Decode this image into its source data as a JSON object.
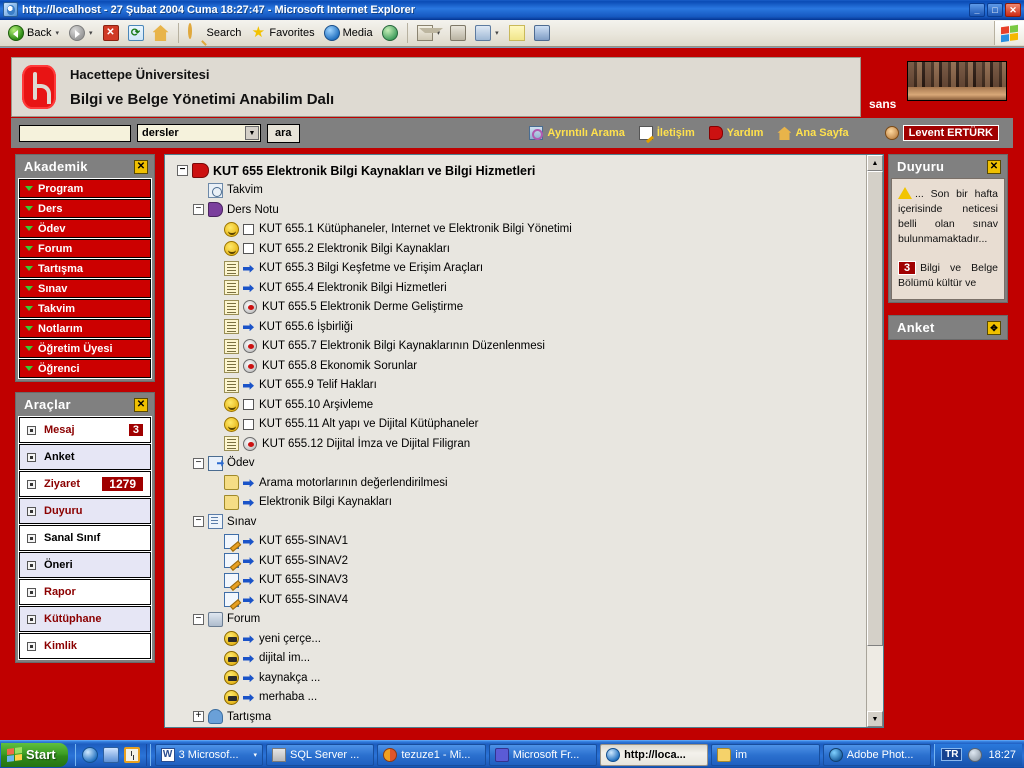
{
  "window": {
    "title": "http://localhost - 27 Şubat 2004 Cuma 18:27:47 - Microsoft Internet Explorer",
    "minimize": "_",
    "maximize": "□",
    "close": "✕"
  },
  "toolbar": {
    "back": "Back",
    "back_caret": "▾",
    "forward_caret": "▾",
    "stop": "✕",
    "refresh": "⟳",
    "search": "Search",
    "favorites": "Favorites",
    "media": "Media",
    "mail_caret": "▾",
    "print_caret": "▾",
    "history_caret": "▾"
  },
  "site": {
    "university": "Hacettepe Üniversitesi",
    "department": "Bilgi ve Belge Yönetimi Anabilim Dalı",
    "photo_caption": "sans"
  },
  "search": {
    "value": "",
    "placeholder": "",
    "selected": "dersler",
    "select_caret": "▼",
    "button": "ara",
    "links": [
      {
        "icon": "detailed-search-icon",
        "label": "Ayrıntılı Arama"
      },
      {
        "icon": "contact-icon",
        "label": "İletişim"
      },
      {
        "icon": "help-icon",
        "label": "Yardım"
      },
      {
        "icon": "home-icon",
        "label": "Ana Sayfa"
      }
    ],
    "user": "Levent ERTÜRK"
  },
  "sidebar": {
    "academic": {
      "title": "Akademik",
      "close": "✕",
      "items": [
        "Program",
        "Ders",
        "Ödev",
        "Forum",
        "Tartışma",
        "Sınav",
        "Takvim",
        "Notlarım",
        "Öğretim Üyesi",
        "Öğrenci"
      ]
    },
    "tools": {
      "title": "Araçlar",
      "close": "✕",
      "items": [
        {
          "label": "Mesaj",
          "badge": "3",
          "style": "dark"
        },
        {
          "label": "Anket",
          "badge": "",
          "style": "black"
        },
        {
          "label": "Ziyaret",
          "badge": "1279",
          "style": "dark"
        },
        {
          "label": "Duyuru",
          "badge": "",
          "style": "dark"
        },
        {
          "label": "Sanal Sınıf",
          "badge": "",
          "style": "black"
        },
        {
          "label": "Öneri",
          "badge": "",
          "style": "black"
        },
        {
          "label": "Rapor",
          "badge": "",
          "style": "dark"
        },
        {
          "label": "Kütüphane",
          "badge": "",
          "style": "dark"
        },
        {
          "label": "Kimlik",
          "badge": "",
          "style": "dark"
        }
      ]
    }
  },
  "tree": {
    "rows": [
      {
        "indent": 0,
        "expander": "−",
        "icon": "book-icon",
        "marker": "",
        "label": "KUT 655  Elektronik Bilgi Kaynakları ve Bilgi Hizmetleri",
        "big": true
      },
      {
        "indent": 1,
        "expander": "",
        "icon": "calendar-icon",
        "marker": "",
        "label": "Takvim"
      },
      {
        "indent": 1,
        "expander": "−",
        "icon": "notes-icon",
        "marker": "",
        "label": "Ders Notu"
      },
      {
        "indent": 2,
        "expander": "",
        "icon": "face-icon",
        "marker": "checkbox",
        "label": "KUT 655.1 Kütüphaneler, Internet ve Elektronik Bilgi Yönetimi"
      },
      {
        "indent": 2,
        "expander": "",
        "icon": "face-icon",
        "marker": "checkbox",
        "label": "KUT 655.2 Elektronik Bilgi Kaynakları"
      },
      {
        "indent": 2,
        "expander": "",
        "icon": "document-icon",
        "marker": "arrow",
        "label": "KUT 655.3 Bilgi Keşfetme ve Erişim Araçları"
      },
      {
        "indent": 2,
        "expander": "",
        "icon": "document-icon",
        "marker": "arrow",
        "label": "KUT 655.4 Elektronik Bilgi Hizmetleri"
      },
      {
        "indent": 2,
        "expander": "",
        "icon": "document-icon",
        "marker": "smiley",
        "label": "KUT 655.5 Elektronik Derme Geliştirme"
      },
      {
        "indent": 2,
        "expander": "",
        "icon": "document-icon",
        "marker": "arrow",
        "label": "KUT 655.6 İşbirliği"
      },
      {
        "indent": 2,
        "expander": "",
        "icon": "document-icon",
        "marker": "smiley",
        "label": "KUT 655.7 Elektronik Bilgi Kaynaklarının Düzenlenmesi"
      },
      {
        "indent": 2,
        "expander": "",
        "icon": "document-icon",
        "marker": "smiley",
        "label": "KUT 655.8 Ekonomik Sorunlar"
      },
      {
        "indent": 2,
        "expander": "",
        "icon": "document-icon",
        "marker": "arrow",
        "label": "KUT 655.9 Telif Hakları"
      },
      {
        "indent": 2,
        "expander": "",
        "icon": "face-icon",
        "marker": "checkbox",
        "label": "KUT 655.10 Arşivleme"
      },
      {
        "indent": 2,
        "expander": "",
        "icon": "face-icon",
        "marker": "checkbox",
        "label": "KUT 655.11 Alt yapı ve Dijital Kütüphaneler"
      },
      {
        "indent": 2,
        "expander": "",
        "icon": "document-icon",
        "marker": "smiley",
        "label": "KUT 655.12 Dijital İmza ve Dijital Filigran"
      },
      {
        "indent": 1,
        "expander": "−",
        "icon": "assignment-icon",
        "marker": "",
        "label": "Ödev"
      },
      {
        "indent": 2,
        "expander": "",
        "icon": "folder-icon",
        "marker": "arrow",
        "label": "Arama motorlarının değerlendirilmesi"
      },
      {
        "indent": 2,
        "expander": "",
        "icon": "folder-icon",
        "marker": "arrow",
        "label": "Elektronik Bilgi Kaynakları"
      },
      {
        "indent": 1,
        "expander": "−",
        "icon": "exam-icon",
        "marker": "",
        "label": "Sınav"
      },
      {
        "indent": 2,
        "expander": "",
        "icon": "quiz-icon",
        "marker": "arrow",
        "label": "KUT 655-SINAV1"
      },
      {
        "indent": 2,
        "expander": "",
        "icon": "quiz-icon",
        "marker": "arrow",
        "label": "KUT 655-SINAV2"
      },
      {
        "indent": 2,
        "expander": "",
        "icon": "quiz-icon",
        "marker": "arrow",
        "label": "KUT 655-SINAV3"
      },
      {
        "indent": 2,
        "expander": "",
        "icon": "quiz-icon",
        "marker": "arrow",
        "label": "KUT 655-SINAV4"
      },
      {
        "indent": 1,
        "expander": "−",
        "icon": "forum-icon",
        "marker": "",
        "label": "Forum"
      },
      {
        "indent": 2,
        "expander": "",
        "icon": "message-face-icon",
        "marker": "arrow",
        "label": "yeni çerçe..."
      },
      {
        "indent": 2,
        "expander": "",
        "icon": "message-face-icon",
        "marker": "arrow",
        "label": "dijital im..."
      },
      {
        "indent": 2,
        "expander": "",
        "icon": "message-face-icon",
        "marker": "arrow",
        "label": "kaynakça ..."
      },
      {
        "indent": 2,
        "expander": "",
        "icon": "message-face-icon",
        "marker": "arrow",
        "label": "merhaba ..."
      },
      {
        "indent": 1,
        "expander": "+",
        "icon": "people-icon",
        "marker": "",
        "label": "Tartışma"
      }
    ]
  },
  "right": {
    "announcement": {
      "title": "Duyuru",
      "close": "✕",
      "text": "... Son bir hafta içerisinde neticesi belli olan sınav bulunmamaktadır...",
      "badge": "3",
      "text2": "Bilgi ve Belge Bölümü kültür ve"
    },
    "poll": {
      "title": "Anket",
      "move": "✥"
    }
  },
  "taskbar": {
    "start": "Start",
    "quick_launch": [
      "ie-icon",
      "outlook-icon",
      "clock-icon"
    ],
    "tasks": [
      {
        "icon": "word-icon",
        "label": "3 Microsof...",
        "caret": "▾",
        "active": false
      },
      {
        "icon": "sql-icon",
        "label": "SQL Server ...",
        "caret": "",
        "active": false
      },
      {
        "icon": "tezuze-icon",
        "label": "tezuze1 - Mi...",
        "caret": "",
        "active": false
      },
      {
        "icon": "frontpage-icon",
        "label": "Microsoft Fr...",
        "caret": "",
        "active": false
      },
      {
        "icon": "ie-icon",
        "label": "http://loca...",
        "caret": "",
        "active": true
      },
      {
        "icon": "folder-icon",
        "label": "im",
        "caret": "",
        "active": false
      },
      {
        "icon": "photoshop-icon",
        "label": "Adobe Phot...",
        "caret": "",
        "active": false
      }
    ],
    "tray_lang": "TR",
    "tray_clock": "18:27"
  },
  "colors": {
    "brand_red": "#c00000",
    "menu_red": "#cc0000",
    "panel_gray": "#808080",
    "accent_yellow": "#ffe14d",
    "badge_red": "#a00000"
  }
}
